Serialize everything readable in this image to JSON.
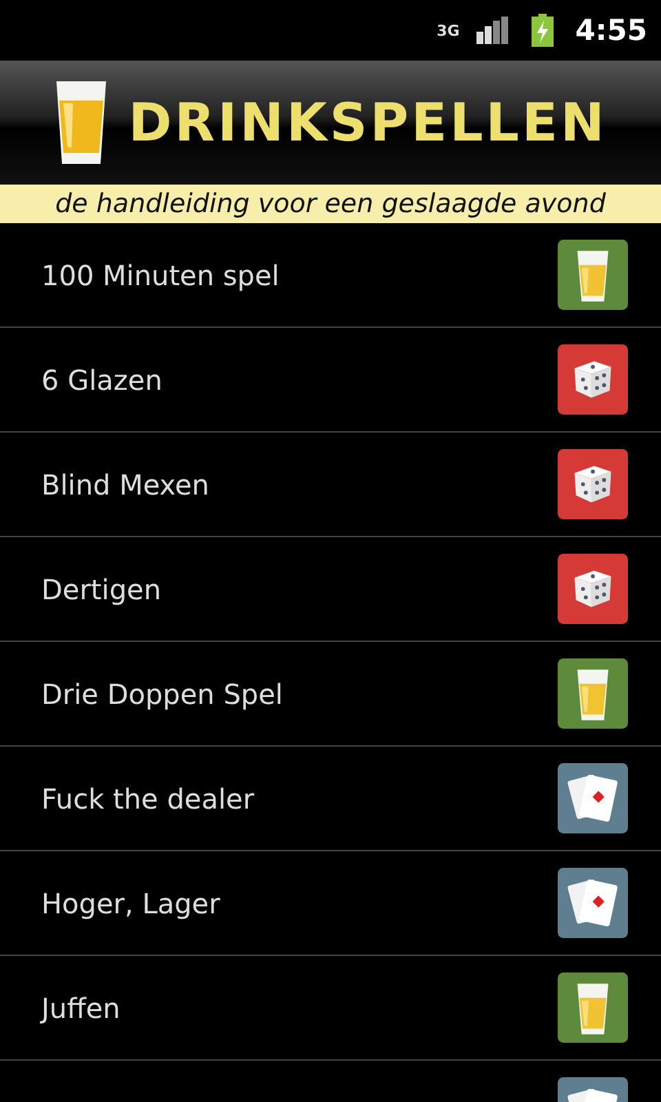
{
  "status_bar": {
    "time": "4:55",
    "network": "3G"
  },
  "header": {
    "title": "DRINKSPELLEN",
    "subtitle": "de handleiding voor een geslaagde avond"
  },
  "games": [
    {
      "label": "100 Minuten spel",
      "kind": "beer"
    },
    {
      "label": "6 Glazen",
      "kind": "dice"
    },
    {
      "label": "Blind Mexen",
      "kind": "dice"
    },
    {
      "label": "Dertigen",
      "kind": "dice"
    },
    {
      "label": "Drie Doppen Spel",
      "kind": "beer"
    },
    {
      "label": "Fuck the dealer",
      "kind": "cards"
    },
    {
      "label": "Hoger, Lager",
      "kind": "cards"
    },
    {
      "label": "Juffen",
      "kind": "beer"
    },
    {
      "kind": "cards"
    }
  ]
}
